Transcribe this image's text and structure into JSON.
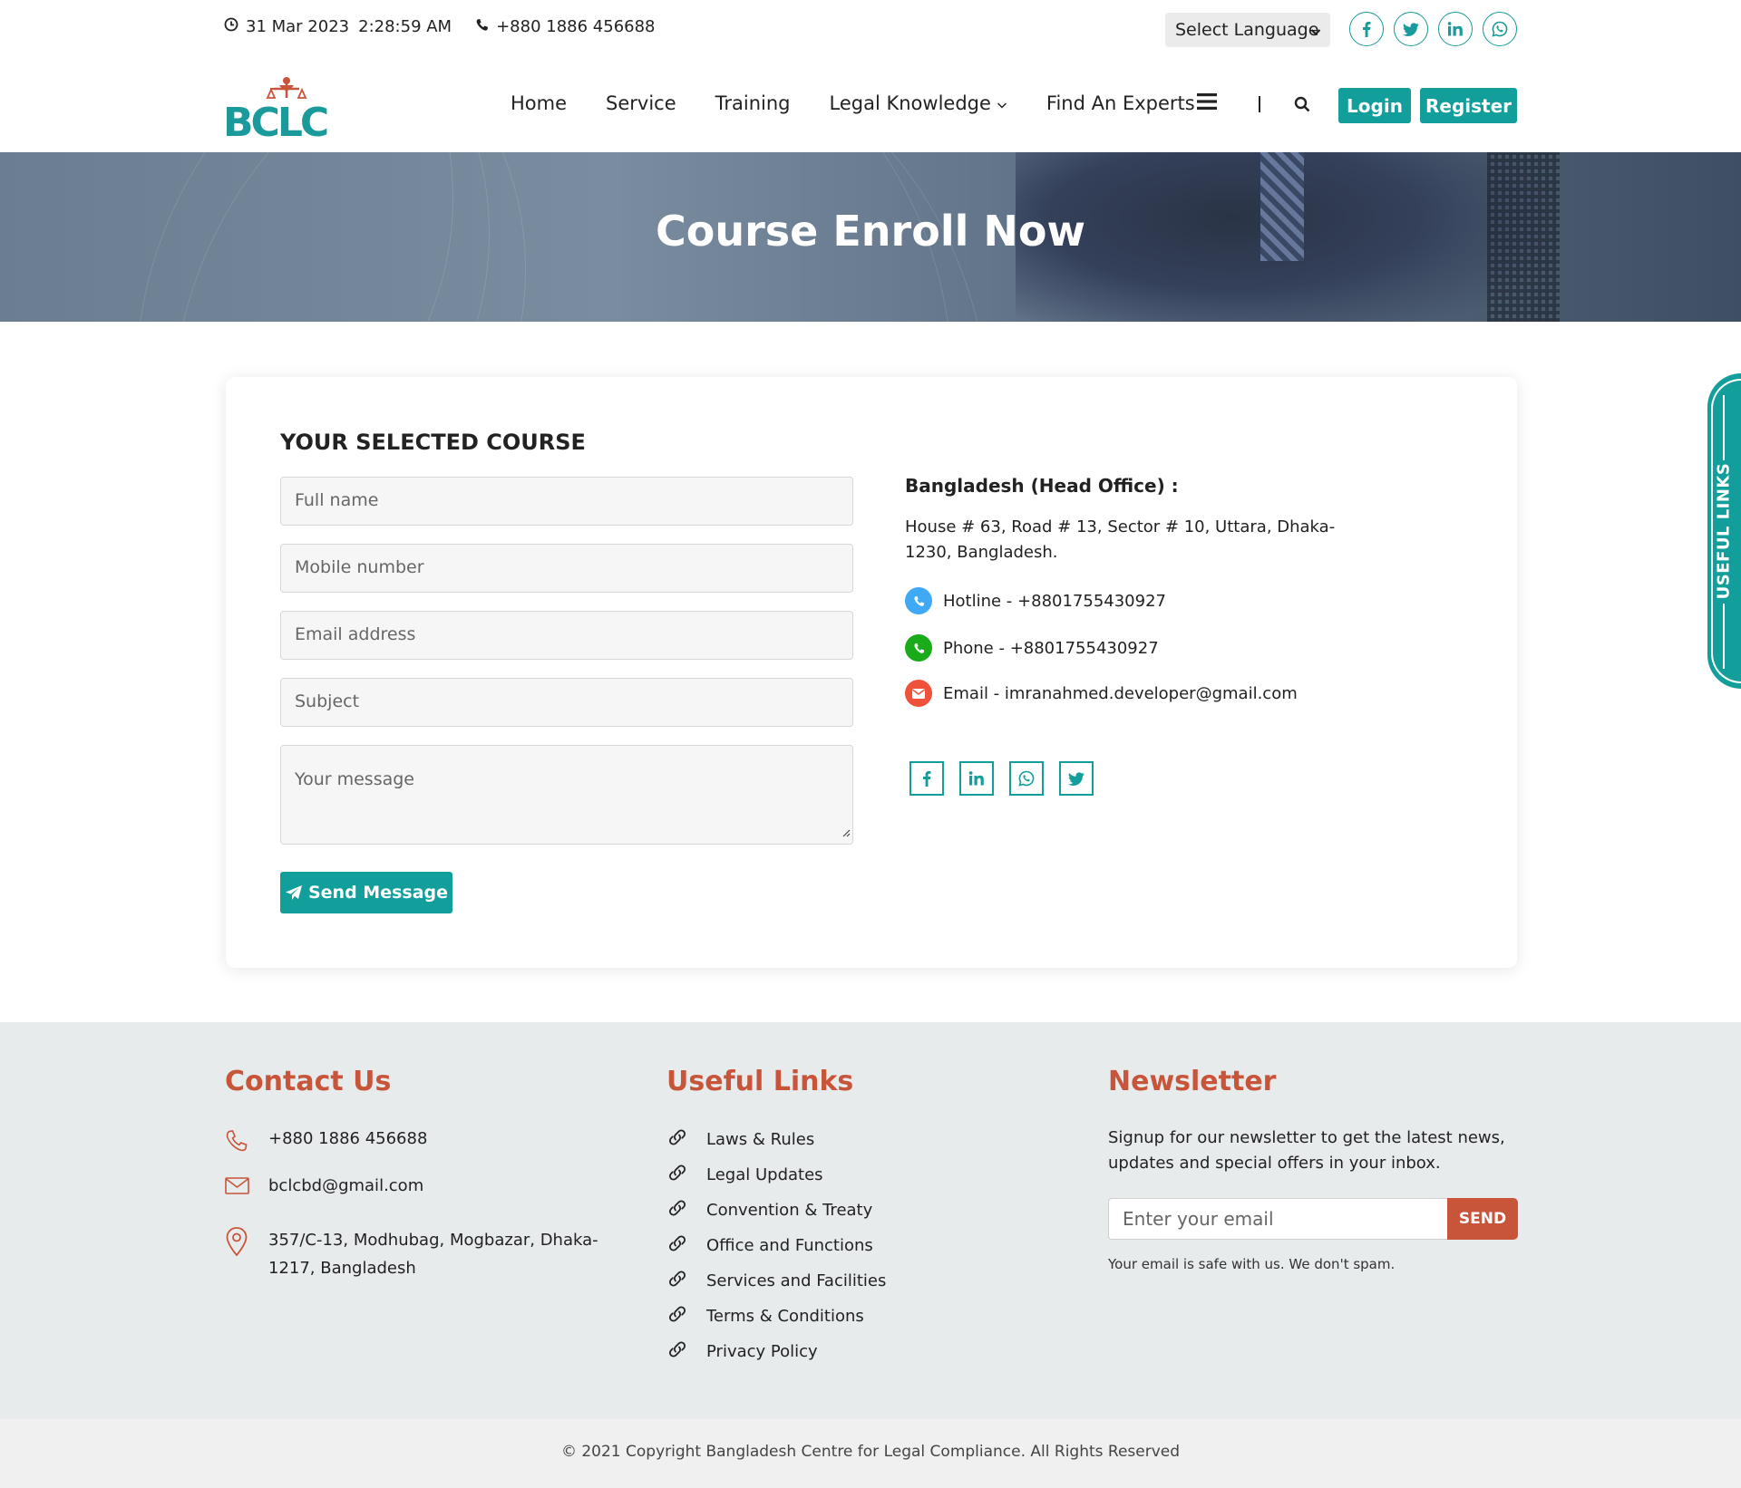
{
  "topbar": {
    "date": "31 Mar 2023",
    "time": "2:28:59 AM",
    "phone": "+880 1886 456688",
    "language_select": "Select Language",
    "social": [
      "facebook-icon",
      "twitter-icon",
      "linkedin-icon",
      "whatsapp-icon"
    ]
  },
  "nav": {
    "brand": "BCLC",
    "items": [
      "Home",
      "Service",
      "Training",
      "Legal Knowledge",
      "Find An Experts"
    ],
    "login": "Login",
    "register": "Register"
  },
  "banner": {
    "title": "Course Enroll Now"
  },
  "form": {
    "heading": "YOUR SELECTED COURSE",
    "full_name_placeholder": "Full name",
    "mobile_placeholder": "Mobile number",
    "email_placeholder": "Email address",
    "subject_placeholder": "Subject",
    "message_placeholder": "Your message",
    "send_label": "Send Message"
  },
  "office": {
    "title": "Bangladesh (Head Office) :",
    "address": "House # 63, Road # 13, Sector # 10, Uttara, Dhaka-1230, Bangladesh.",
    "hotline": "Hotline - +8801755430927",
    "phone": "Phone - +8801755430927",
    "email": "Email - imranahmed.developer@gmail.com"
  },
  "side_tab": {
    "label": "USEFUL LINKS"
  },
  "footer": {
    "contact_title": "Contact Us",
    "contact_phone": "+880 1886 456688",
    "contact_email": "bclcbd@gmail.com",
    "contact_address": "357/C-13, Modhubag, Mogbazar, Dhaka-1217, Bangladesh",
    "links_title": "Useful Links",
    "links": [
      "Laws & Rules",
      "Legal Updates",
      "Convention & Treaty",
      "Office and Functions",
      "Services and Facilities",
      "Terms & Conditions",
      "Privacy Policy"
    ],
    "newsletter_title": "Newsletter",
    "newsletter_text": "Signup for our newsletter to get the latest news, updates and special offers in your inbox.",
    "newsletter_placeholder": "Enter your email",
    "newsletter_button": "SEND",
    "newsletter_note": "Your email is safe with us. We don't spam."
  },
  "copyright": "© 2021 Copyright Bangladesh Centre for Legal Compliance. All Rights Reserved",
  "colors": {
    "accent": "#129e9b",
    "footer_heading": "#c8553a",
    "hotline_icon": "#3fa9f5",
    "phone_icon": "#1aab1a",
    "email_icon": "#f0513a"
  }
}
